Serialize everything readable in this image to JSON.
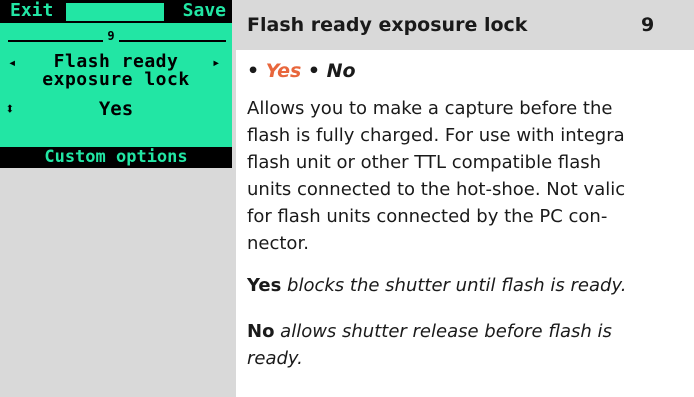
{
  "lcd": {
    "exit_label": "Exit",
    "save_label": "Save",
    "page_number": "9",
    "left_arrow": "◂",
    "right_arrow": "▸",
    "setting_line1": "Flash ready",
    "setting_line2": "exposure lock",
    "updown_symbol": "⬍",
    "value": "Yes",
    "footer": "Custom options",
    "bg_color": "#22e6a4"
  },
  "header": {
    "title": "Flash ready exposure lock",
    "number": "9"
  },
  "options": {
    "bullet1": "• ",
    "yes": "Yes",
    "bullet2": " • ",
    "no": "No"
  },
  "description": {
    "lines": [
      "Allows you to make a capture before the",
      "flash is fully charged. For use with integra",
      "flash unit or other TTL compatible flash",
      "units connected to the hot-shoe. Not valic",
      "for flash units connected by the PC con-",
      "nector."
    ]
  },
  "yes_desc": {
    "term": "Yes",
    "text": " blocks the shutter until flash is ready."
  },
  "no_desc": {
    "term": "No",
    "text_line1": " allows shutter release before flash is",
    "text_line2": "ready."
  }
}
